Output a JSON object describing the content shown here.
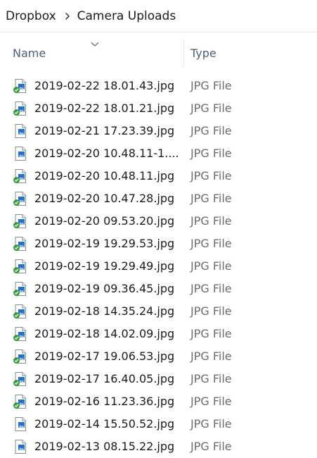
{
  "breadcrumb": {
    "root": "Dropbox",
    "current": "Camera Uploads",
    "separator_icon": "chevron-right-icon"
  },
  "columns": {
    "name": "Name",
    "type": "Type",
    "sort_icon": "chevron-down-icon"
  },
  "colors": {
    "sync_ok": "#3a9a3a",
    "image_blue": "#2470c8"
  },
  "files": [
    {
      "name": "2019-02-22 18.01.43.jpg",
      "type": "JPG File",
      "synced": true
    },
    {
      "name": "2019-02-22 18.01.21.jpg",
      "type": "JPG File",
      "synced": true
    },
    {
      "name": "2019-02-21 17.23.39.jpg",
      "type": "JPG File",
      "synced": false
    },
    {
      "name": "2019-02-20 10.48.11-1....",
      "type": "JPG File",
      "synced": false
    },
    {
      "name": "2019-02-20 10.48.11.jpg",
      "type": "JPG File",
      "synced": true
    },
    {
      "name": "2019-02-20 10.47.28.jpg",
      "type": "JPG File",
      "synced": true
    },
    {
      "name": "2019-02-20 09.53.20.jpg",
      "type": "JPG File",
      "synced": true
    },
    {
      "name": "2019-02-19 19.29.53.jpg",
      "type": "JPG File",
      "synced": true
    },
    {
      "name": "2019-02-19 19.29.49.jpg",
      "type": "JPG File",
      "synced": true
    },
    {
      "name": "2019-02-19 09.36.45.jpg",
      "type": "JPG File",
      "synced": true
    },
    {
      "name": "2019-02-18 14.35.24.jpg",
      "type": "JPG File",
      "synced": true
    },
    {
      "name": "2019-02-18 14.02.09.jpg",
      "type": "JPG File",
      "synced": true
    },
    {
      "name": "2019-02-17 19.06.53.jpg",
      "type": "JPG File",
      "synced": true
    },
    {
      "name": "2019-02-17 16.40.05.jpg",
      "type": "JPG File",
      "synced": true
    },
    {
      "name": "2019-02-16 11.23.36.jpg",
      "type": "JPG File",
      "synced": true
    },
    {
      "name": "2019-02-14 15.50.52.jpg",
      "type": "JPG File",
      "synced": false
    },
    {
      "name": "2019-02-13 08.15.22.jpg",
      "type": "JPG File",
      "synced": false
    }
  ]
}
